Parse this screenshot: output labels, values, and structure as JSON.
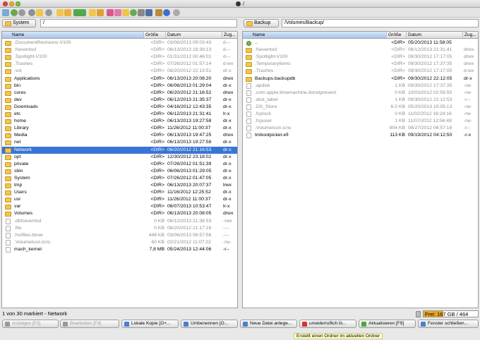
{
  "window": {
    "title": "/"
  },
  "left": {
    "drive": "System",
    "path": "/",
    "columns": [
      "Name",
      "Größe",
      "Datum",
      "Zug..."
    ],
    "rows": [
      {
        "name": ".DocumentRevisions-V100",
        "size": "<DIR>",
        "date": "03/06/2013 09:03:43",
        "attr": "d---",
        "type": "folder",
        "hidden": true
      },
      {
        "name": ".fseventsd",
        "size": "<DIR>",
        "date": "06/13/2013 18:39:13",
        "attr": "d---",
        "type": "folder",
        "hidden": true
      },
      {
        "name": ".Spotlight-V100",
        "size": "<DIR>",
        "date": "01/31/2012 00:46:01",
        "attr": "d---",
        "type": "folder",
        "hidden": true
      },
      {
        "name": ".Trashes",
        "size": "<DIR>",
        "date": "07/26/2012 01:57:14",
        "attr": "d-wx",
        "type": "folder",
        "hidden": true
      },
      {
        "name": ".vol",
        "size": "<DIR>",
        "date": "06/20/2012 22:13:51",
        "attr": "dr-x",
        "type": "folder",
        "hidden": true
      },
      {
        "name": "Applications",
        "size": "<DIR>",
        "date": "06/13/2013 20:08:20",
        "attr": "drwx",
        "type": "folder",
        "hidden": false
      },
      {
        "name": "bin",
        "size": "<DIR>",
        "date": "06/06/2013 01:29:04",
        "attr": "dr-x",
        "type": "folder",
        "hidden": false
      },
      {
        "name": "cores",
        "size": "<DIR>",
        "date": "06/20/2012 21:16:52",
        "attr": "drwx",
        "type": "folder",
        "hidden": false
      },
      {
        "name": "dev",
        "size": "<DIR>",
        "date": "06/12/2013 21:35:37",
        "attr": "dr-x",
        "type": "folder",
        "hidden": false
      },
      {
        "name": "Downloads",
        "size": "<DIR>",
        "date": "04/16/2012 12:43:35",
        "attr": "dr-x",
        "type": "folder",
        "hidden": false
      },
      {
        "name": "etc",
        "size": "<DIR>",
        "date": "06/12/2013 21:31:41",
        "attr": "lr-x",
        "type": "link",
        "hidden": false
      },
      {
        "name": "home",
        "size": "<DIR>",
        "date": "06/13/2013 19:27:58",
        "attr": "dr-x",
        "type": "folder",
        "hidden": false
      },
      {
        "name": "Library",
        "size": "<DIR>",
        "date": "11/26/2012 11:00:37",
        "attr": "dr-x",
        "type": "folder",
        "hidden": false
      },
      {
        "name": "Media",
        "size": "<DIR>",
        "date": "06/13/2013 19:47:25",
        "attr": "drwx",
        "type": "folder",
        "hidden": false
      },
      {
        "name": "net",
        "size": "<DIR>",
        "date": "06/13/2013 19:27:58",
        "attr": "dr-x",
        "type": "folder",
        "hidden": false
      },
      {
        "name": "Network",
        "size": "<DIR>",
        "date": "06/20/2012 21:16:53",
        "attr": "dr-x",
        "type": "folder",
        "hidden": false,
        "selected": true
      },
      {
        "name": "opt",
        "size": "<DIR>",
        "date": "12/30/2012 23:18:02",
        "attr": "dr-x",
        "type": "folder",
        "hidden": false
      },
      {
        "name": "private",
        "size": "<DIR>",
        "date": "07/26/2012 01:51:39",
        "attr": "dr-x",
        "type": "folder",
        "hidden": false
      },
      {
        "name": "sbin",
        "size": "<DIR>",
        "date": "06/06/2013 01:29:05",
        "attr": "dr-x",
        "type": "folder",
        "hidden": false
      },
      {
        "name": "System",
        "size": "<DIR>",
        "date": "07/26/2012 01:47:05",
        "attr": "dr-x",
        "type": "folder",
        "hidden": false
      },
      {
        "name": "tmp",
        "size": "<DIR>",
        "date": "06/13/2013 20:07:37",
        "attr": "lrwx",
        "type": "link",
        "hidden": false
      },
      {
        "name": "Users",
        "size": "<DIR>",
        "date": "11/16/2012 12:25:52",
        "attr": "dr-x",
        "type": "folder",
        "hidden": false
      },
      {
        "name": "usr",
        "size": "<DIR>",
        "date": "11/26/2012 11:00:37",
        "attr": "dr-x",
        "type": "folder",
        "hidden": false
      },
      {
        "name": "var",
        "size": "<DIR>",
        "date": "06/07/2013 10:53:47",
        "attr": "lr-x",
        "type": "link",
        "hidden": false
      },
      {
        "name": "Volumes",
        "size": "<DIR>",
        "date": "06/13/2013 20:08:05",
        "attr": "drwx",
        "type": "folder",
        "hidden": false
      },
      {
        "name": ".dbfseventsd",
        "size": "0 KB",
        "date": "06/12/2013 21:38:53",
        "attr": "-rwx",
        "type": "file",
        "hidden": true
      },
      {
        "name": ".file",
        "size": "0 KB",
        "date": "06/20/2012 21:17:16",
        "attr": "----",
        "type": "file",
        "hidden": true
      },
      {
        "name": ".hotfiles.btree",
        "size": "448 KB",
        "date": "03/06/2013 08:57:56",
        "attr": "----",
        "type": "file",
        "hidden": true
      },
      {
        "name": ".VolumeIcon.icns",
        "size": "60 KB",
        "date": "02/21/2012 11:07:22",
        "attr": "-rw-",
        "type": "file",
        "hidden": true
      },
      {
        "name": "mach_kernel",
        "size": "7,8 MB",
        "date": "05/24/2013 12:44:06",
        "attr": "-r--",
        "type": "file",
        "hidden": false
      }
    ]
  },
  "right": {
    "drive": "Backup",
    "path": "/Volumes/Backup/",
    "columns": [
      "Name",
      "Größe",
      "Datum",
      "Zug..."
    ],
    "rows": [
      {
        "name": "..",
        "size": "<DIR>",
        "date": "05/20/2013 11:58:05",
        "attr": "",
        "type": "up",
        "hidden": false
      },
      {
        "name": ".fseventsd",
        "size": "<DIR>",
        "date": "06/12/2013 21:31:41",
        "attr": "drwx",
        "type": "folder",
        "hidden": true
      },
      {
        "name": ".Spotlight-V100",
        "size": "<DIR>",
        "date": "09/30/2012 17:17:05",
        "attr": "drwx",
        "type": "folder",
        "hidden": true
      },
      {
        "name": ".TemporaryItems",
        "size": "<DIR>",
        "date": "09/30/2012 17:37:35",
        "attr": "drwx",
        "type": "folder",
        "hidden": true
      },
      {
        "name": ".Trashes",
        "size": "<DIR>",
        "date": "09/30/2012 17:17:05",
        "attr": "d-wx",
        "type": "folder",
        "hidden": true
      },
      {
        "name": "Backups.backupdb",
        "size": "<DIR>",
        "date": "09/30/2012 22:12:05",
        "attr": "dr-x",
        "type": "folder",
        "hidden": false
      },
      {
        "name": ".apdisk",
        "size": "1 KB",
        "date": "09/30/2012 17:37:35",
        "attr": "-rw-",
        "type": "file",
        "hidden": true
      },
      {
        "name": ".com.apple.timemachine.donotpresent",
        "size": "0 KB",
        "date": "10/03/2012 02:56:50",
        "attr": "-rw-",
        "type": "file",
        "hidden": true
      },
      {
        "name": ".disk_label",
        "size": "1 KB",
        "date": "09/30/2012 22:12:53",
        "attr": "-r--",
        "type": "file",
        "hidden": true
      },
      {
        "name": ".DS_Store",
        "size": "6.0 KB",
        "date": "05/20/2013 15:05:13",
        "attr": "-rw-",
        "type": "file",
        "hidden": true
      },
      {
        "name": ".fcplock",
        "size": "0 KB",
        "date": "11/02/2012 16:24:16",
        "attr": "-rw-",
        "type": "file",
        "hidden": true
      },
      {
        "name": ".fcpuser",
        "size": "1 KB",
        "date": "11/07/2012 12:56:48",
        "attr": "-rw-",
        "type": "file",
        "hidden": true
      },
      {
        "name": ".VolumeIcon.icns",
        "size": "904 KB",
        "date": "06/27/2012 06:57:16",
        "attr": "-r--",
        "type": "file",
        "hidden": true
      },
      {
        "name": "tmbootpicker.efi",
        "size": "113 KB",
        "date": "09/19/2012 04:12:50",
        "attr": "-r-x",
        "type": "file",
        "hidden": false
      }
    ]
  },
  "status": {
    "text": "1 von 30 markiert - Network",
    "free": "Frei: 167 GB / 464 GB",
    "free_fraction": 0.36
  },
  "buttons": [
    {
      "label": "Anzeigen [F3]",
      "disabled": true,
      "color": "#9a9a9a",
      "icon": "view-icon"
    },
    {
      "label": "Bearbeiten [F4]",
      "disabled": true,
      "color": "#9a9a9a",
      "icon": "edit-icon"
    },
    {
      "label": "Lokale Kopie [O+...",
      "disabled": false,
      "color": "#4a7fd0",
      "icon": "copy-icon"
    },
    {
      "label": "Umbenennen [O...",
      "disabled": false,
      "color": "#4a7fd0",
      "icon": "rename-icon"
    },
    {
      "label": "Neue Datei anlege...",
      "disabled": false,
      "color": "#4a7fd0",
      "icon": "new-file-icon"
    },
    {
      "label": "unwiderruflich lö...",
      "disabled": false,
      "color": "#d9342b",
      "icon": "delete-icon"
    },
    {
      "label": "Aktualisieren [F9]",
      "disabled": false,
      "color": "#49a83a",
      "icon": "refresh-icon"
    },
    {
      "label": "Fenster schließen...",
      "disabled": false,
      "color": "#4a7fd0",
      "icon": "close-window-icon"
    }
  ],
  "tooltip": "Erstellt einen Ordner im aktuellen Ordner"
}
